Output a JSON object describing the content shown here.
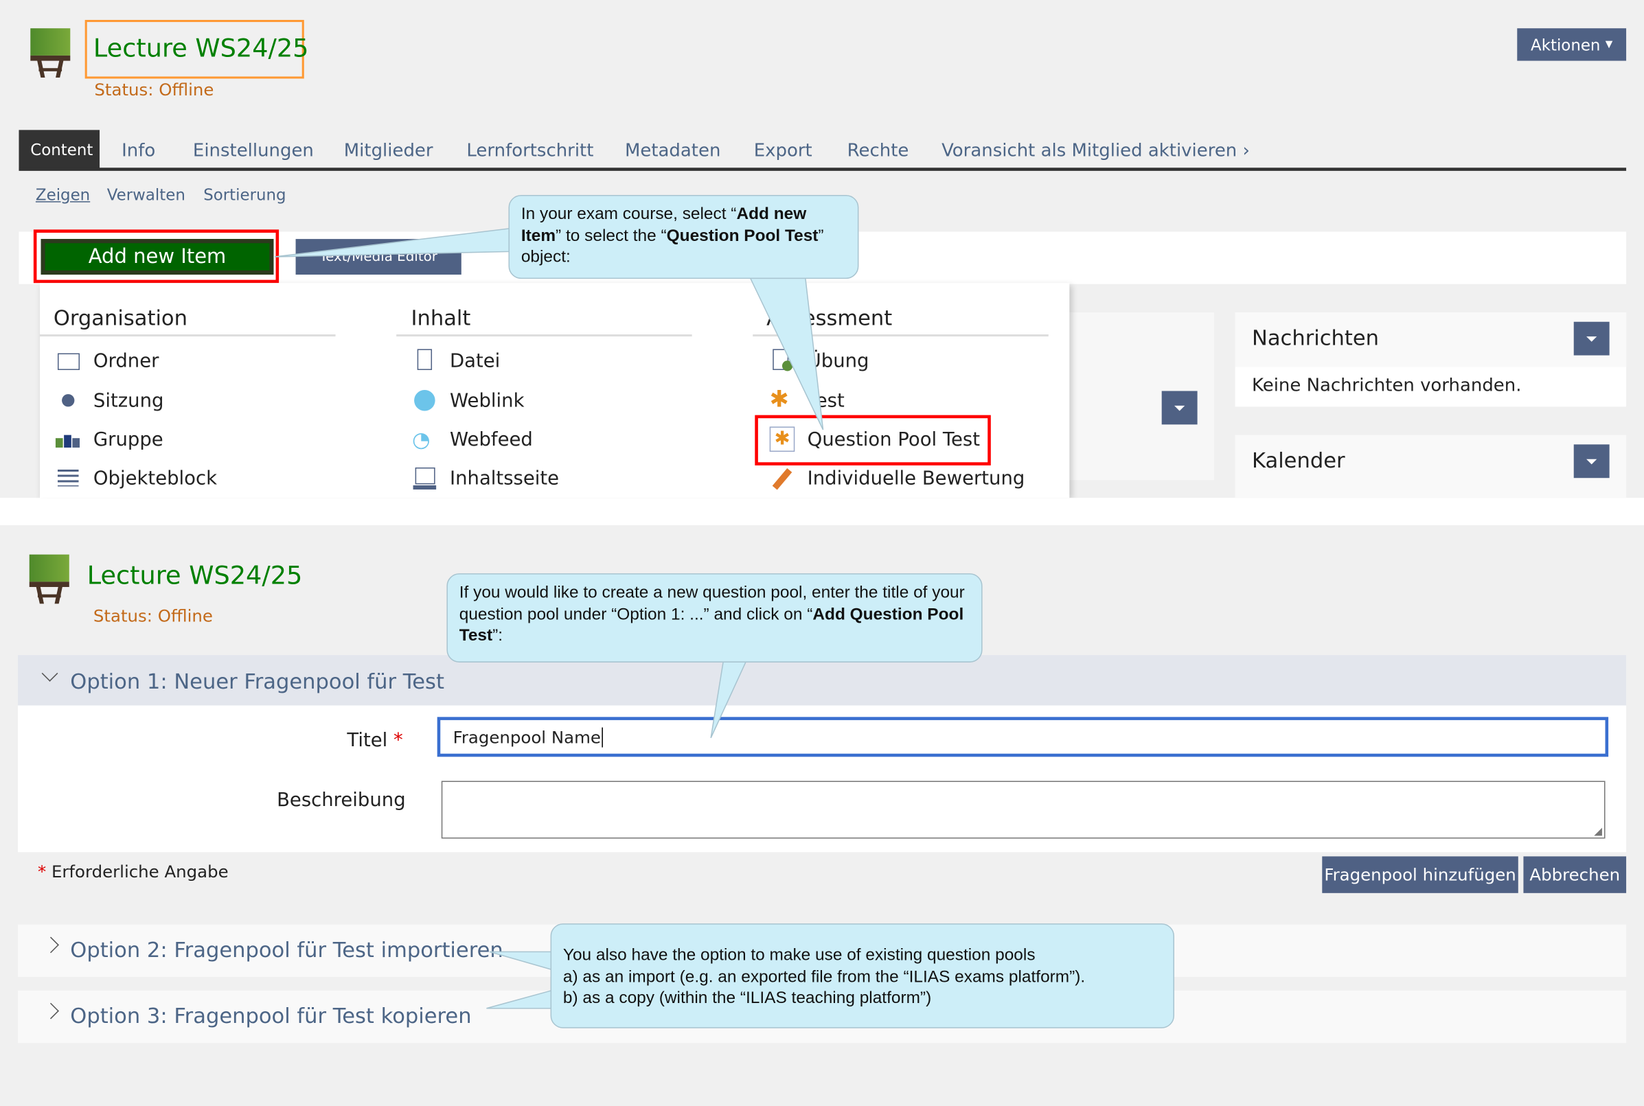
{
  "top": {
    "course_title": "Lecture WS24/25",
    "status": "Status: Offline",
    "actions_label": "Aktionen",
    "tabs": [
      "Content",
      "Info",
      "Einstellungen",
      "Mitglieder",
      "Lernfortschritt",
      "Metadaten",
      "Export",
      "Rechte",
      "Voransicht als Mitglied aktivieren"
    ],
    "subtabs": [
      "Zeigen",
      "Verwalten",
      "Sortierung"
    ],
    "add_new_item": "Add new Item",
    "text_editor_button": "Text/Media Editor",
    "callout": {
      "pre": "In your exam course, select “",
      "b1": "Add new Item",
      "mid": "” to select the “",
      "b2": "Question Pool Test",
      "post": "” object:"
    },
    "menu": {
      "columns": [
        {
          "title": "Organisation",
          "items": [
            {
              "label": "Ordner",
              "icon": "folder-icon"
            },
            {
              "label": "Sitzung",
              "icon": "session-icon"
            },
            {
              "label": "Gruppe",
              "icon": "group-icon"
            },
            {
              "label": "Objekteblock",
              "icon": "item-group-icon"
            }
          ]
        },
        {
          "title": "Inhalt",
          "items": [
            {
              "label": "Datei",
              "icon": "file-icon"
            },
            {
              "label": "Weblink",
              "icon": "weblink-icon"
            },
            {
              "label": "Webfeed",
              "icon": "rss-icon"
            },
            {
              "label": "Inhaltsseite",
              "icon": "content-page-icon"
            }
          ]
        },
        {
          "title": "Assessment",
          "items": [
            {
              "label": "Übung",
              "icon": "exercise-icon"
            },
            {
              "label": "Test",
              "icon": "test-icon"
            },
            {
              "label": "Question Pool Test",
              "icon": "question-pool-icon"
            },
            {
              "label": "Individuelle Bewertung",
              "icon": "individual-assessment-icon"
            }
          ]
        }
      ]
    },
    "side": {
      "news_title": "Nachrichten",
      "news_empty": "Keine Nachrichten vorhanden.",
      "calendar_title": "Kalender"
    }
  },
  "bottom": {
    "course_title": "Lecture WS24/25",
    "status": "Status: Offline",
    "callout": {
      "pre": "If you would like to create a new question pool, enter the title of your question pool under “Option 1: ...” and click on “",
      "b1": "Add Question Pool Test",
      "post": "”:"
    },
    "option1": "Option 1: Neuer Fragenpool für Test",
    "title_label": "Titel",
    "title_value": "Fragenpool Name",
    "description_label": "Beschreibung",
    "required_note": "Erforderliche Angabe",
    "required_star": "*",
    "submit": "Fragenpool hinzufügen",
    "cancel": "Abbrechen",
    "option2": "Option 2: Fragenpool für Test importieren",
    "option3": "Option 3: Fragenpool für Test kopieren",
    "callout2": [
      "You also have the option to make use of existing question pools",
      "a) as an import (e.g. an exported file from the “ILIAS exams platform”).",
      "b) as a copy (within the “ILIAS teaching platform”)"
    ]
  },
  "colors": {
    "title_green": "#008000",
    "status_orange": "#c36a1a",
    "button_blue": "#4f6184",
    "add_green": "#006400",
    "highlight_red": "#ff0000",
    "highlight_orange": "#ff9933",
    "callout_bg": "#cdeef8"
  }
}
